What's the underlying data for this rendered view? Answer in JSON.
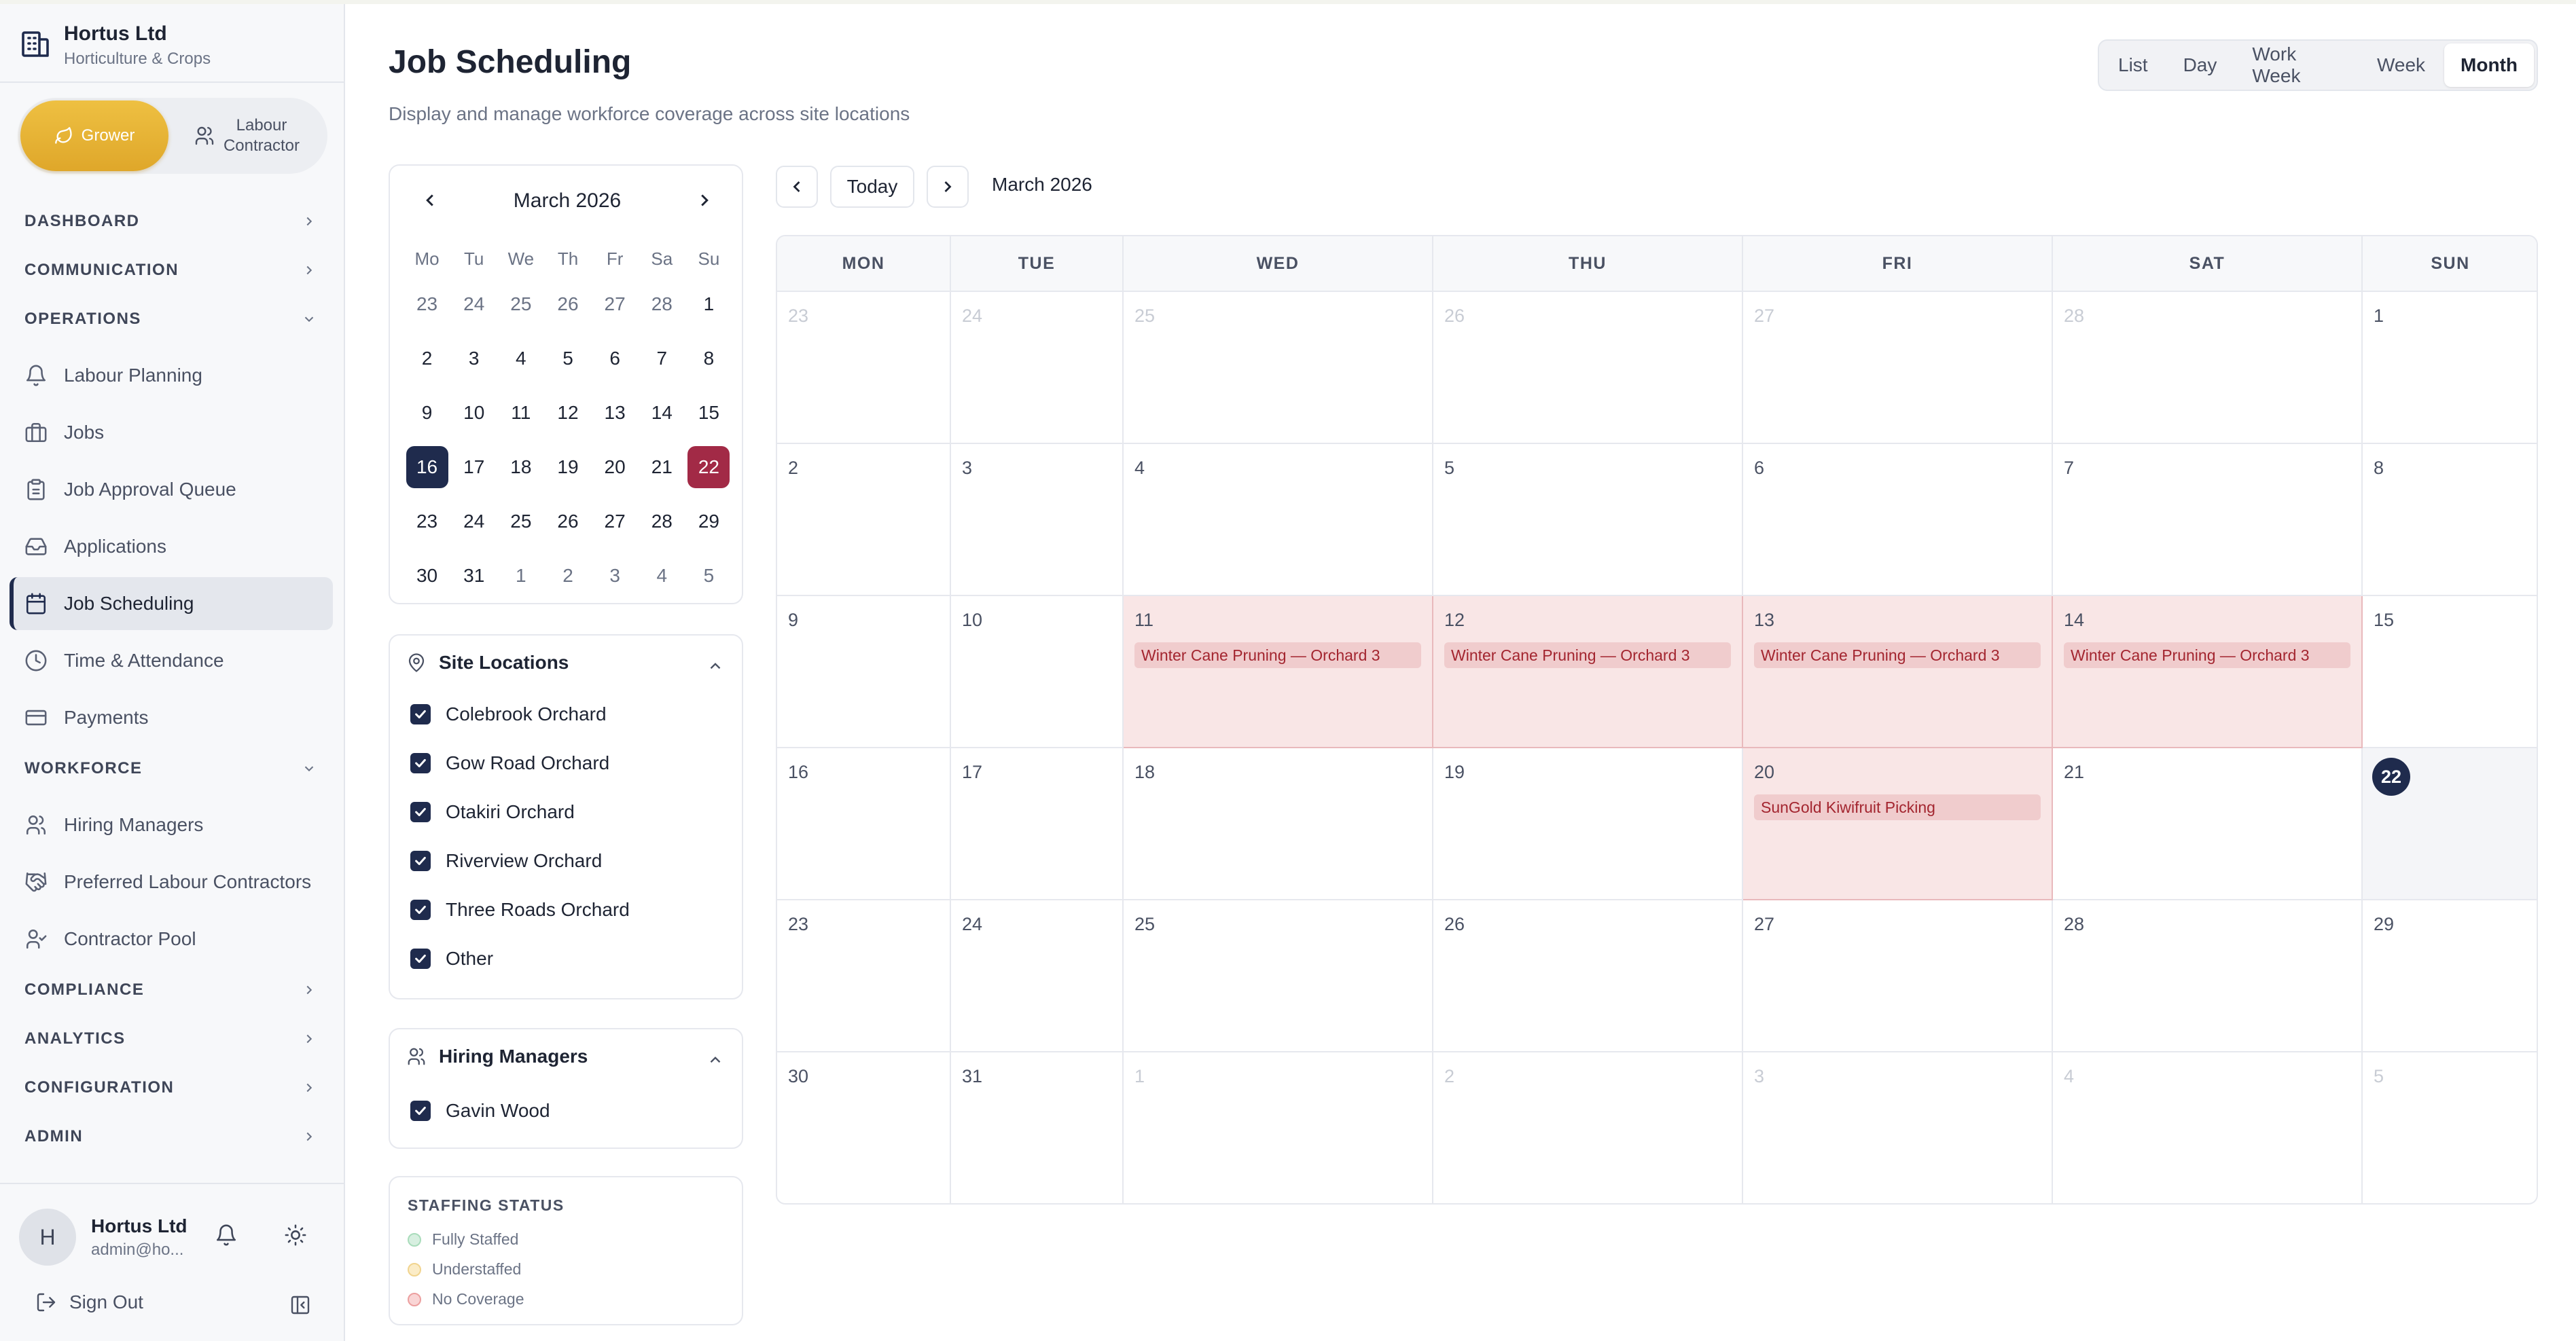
{
  "brand": {
    "name": "Hortus Ltd",
    "subtitle": "Horticulture & Crops"
  },
  "roles": {
    "grower": "Grower",
    "labour_line1": "Labour",
    "labour_line2": "Contractor"
  },
  "nav": {
    "groups": {
      "dashboard": "DASHBOARD",
      "communication": "COMMUNICATION",
      "operations": "OPERATIONS",
      "workforce": "WORKFORCE",
      "compliance": "COMPLIANCE",
      "analytics": "ANALYTICS",
      "configuration": "CONFIGURATION",
      "admin": "ADMIN"
    },
    "operations": [
      "Labour Planning",
      "Jobs",
      "Job Approval Queue",
      "Applications",
      "Job Scheduling",
      "Time & Attendance",
      "Payments"
    ],
    "workforce": [
      "Hiring Managers",
      "Preferred Labour Contractors",
      "Contractor Pool"
    ]
  },
  "user": {
    "initial": "H",
    "name": "Hortus Ltd",
    "email": "admin@ho...",
    "signout": "Sign Out"
  },
  "page": {
    "title": "Job Scheduling",
    "subtitle": "Display and manage workforce coverage across site locations"
  },
  "views": [
    "List",
    "Day",
    "Work Week",
    "Week",
    "Month"
  ],
  "active_view": "Month",
  "mini_calendar": {
    "month_label": "March 2026",
    "weekdays": [
      "Mo",
      "Tu",
      "We",
      "Th",
      "Fr",
      "Sa",
      "Su"
    ],
    "days": [
      "23",
      "24",
      "25",
      "26",
      "27",
      "28",
      "1",
      "2",
      "3",
      "4",
      "5",
      "6",
      "7",
      "8",
      "9",
      "10",
      "11",
      "12",
      "13",
      "14",
      "15",
      "16",
      "17",
      "18",
      "19",
      "20",
      "21",
      "22",
      "23",
      "24",
      "25",
      "26",
      "27",
      "28",
      "29",
      "30",
      "31",
      "1",
      "2",
      "3",
      "4",
      "5"
    ],
    "selected": "16",
    "today": "22"
  },
  "site_locations": {
    "title": "Site Locations",
    "items": [
      "Colebrook Orchard",
      "Gow Road Orchard",
      "Otakiri Orchard",
      "Riverview Orchard",
      "Three Roads Orchard",
      "Other"
    ]
  },
  "hiring_managers": {
    "title": "Hiring Managers",
    "items": [
      "Gavin Wood"
    ]
  },
  "staffing_status": {
    "title": "STAFFING STATUS",
    "fully": "Fully Staffed",
    "under": "Understaffed",
    "none": "No Coverage",
    "colors": {
      "fully": "#bfe6cc",
      "under": "#f7dfa6",
      "none": "#f4b8b8"
    }
  },
  "calendar": {
    "today_label": "Today",
    "month_label": "March 2026",
    "headers": [
      "MON",
      "TUE",
      "WED",
      "THU",
      "FRI",
      "SAT",
      "SUN"
    ],
    "weeks": [
      [
        "23",
        "24",
        "25",
        "26",
        "27",
        "28",
        "1"
      ],
      [
        "2",
        "3",
        "4",
        "5",
        "6",
        "7",
        "8"
      ],
      [
        "9",
        "10",
        "11",
        "12",
        "13",
        "14",
        "15"
      ],
      [
        "16",
        "17",
        "18",
        "19",
        "20",
        "21",
        "22"
      ],
      [
        "23",
        "24",
        "25",
        "26",
        "27",
        "28",
        "29"
      ],
      [
        "30",
        "31",
        "1",
        "2",
        "3",
        "4",
        "5"
      ]
    ],
    "events": {
      "e11": "Winter Cane Pruning — Orchard 3",
      "e12": "Winter Cane Pruning — Orchard 3",
      "e13": "Winter Cane Pruning — Orchard 3",
      "e14": "Winter Cane Pruning — Orchard 3",
      "e20": "SunGold Kiwifruit Picking"
    }
  },
  "colors": {
    "accent_navy": "#1f2b4d",
    "today_red": "#a22a46",
    "grower_gold": "#e3b035",
    "event_bg": "#f0cccd",
    "event_text": "#a3252f"
  }
}
